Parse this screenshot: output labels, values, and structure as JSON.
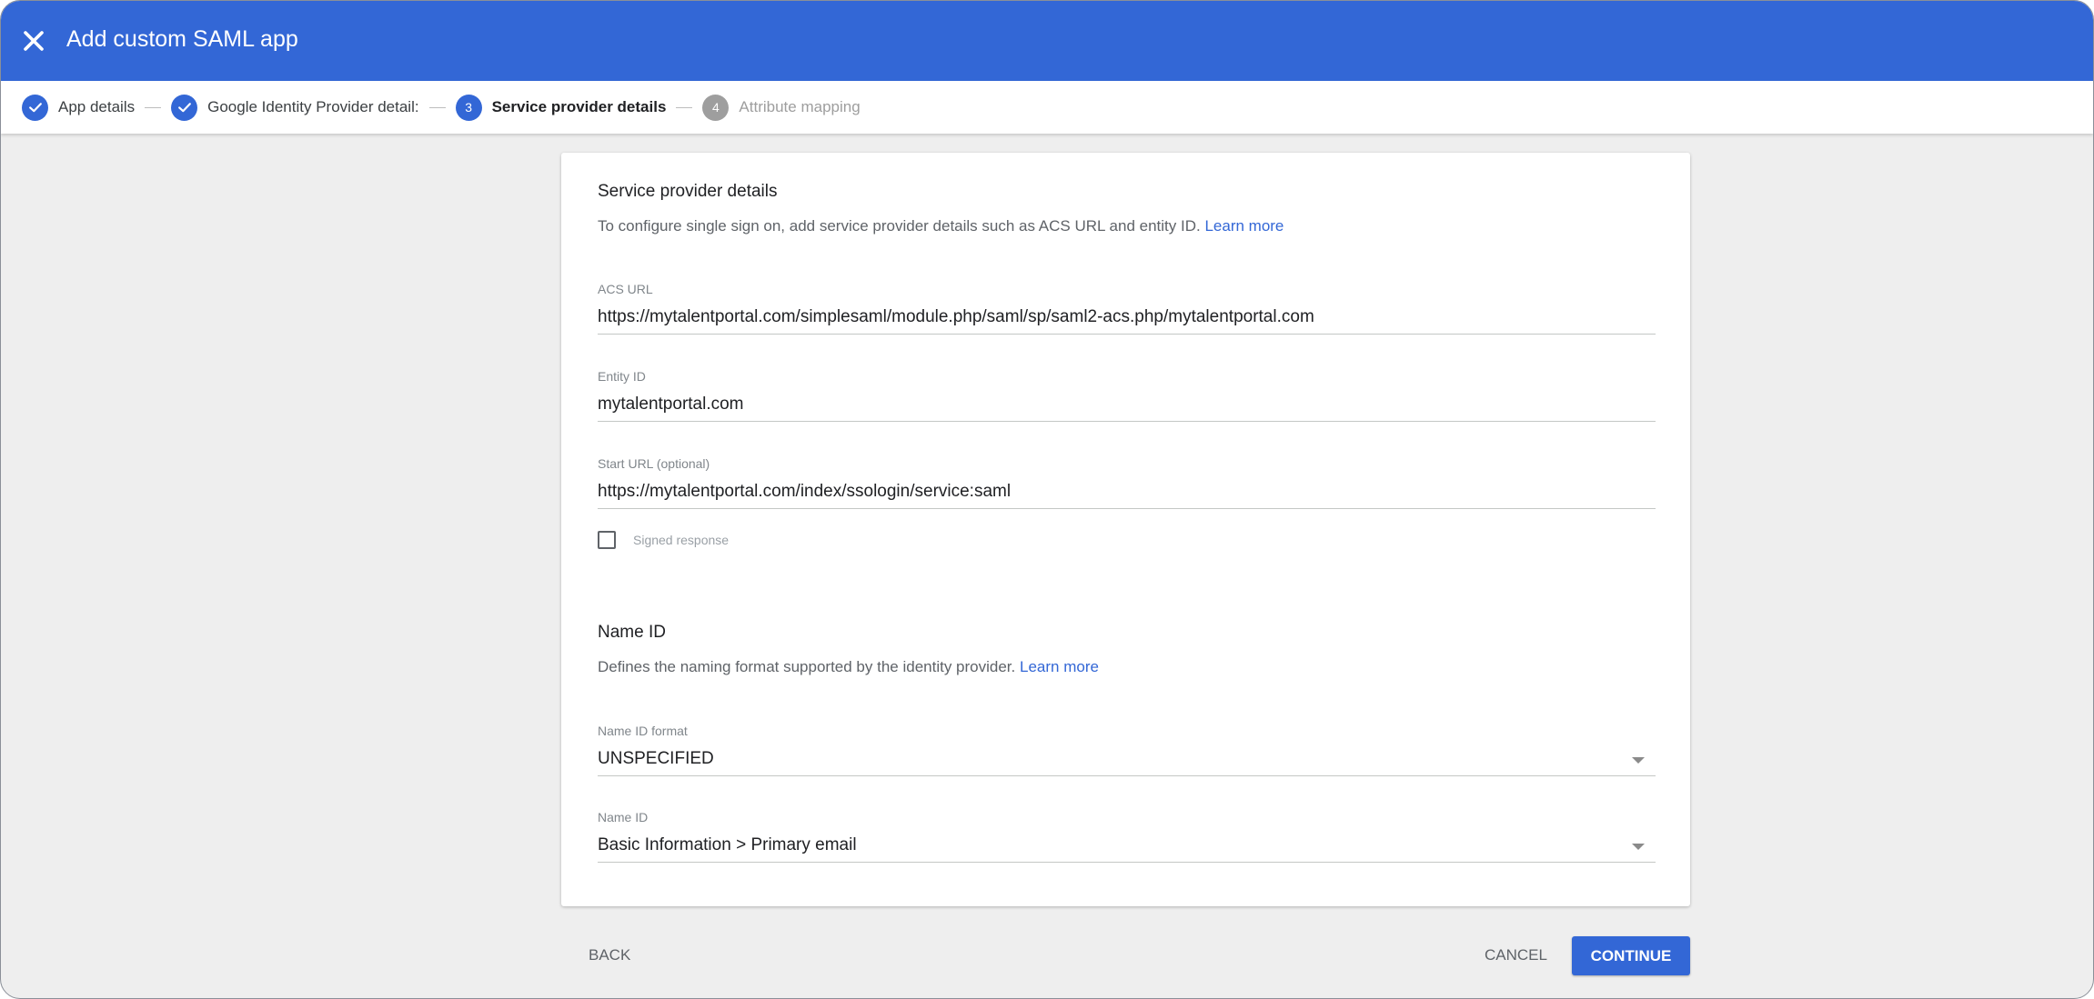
{
  "header": {
    "title": "Add custom SAML app",
    "close_icon": "close-icon",
    "background_color": "#3367d6"
  },
  "stepper": {
    "steps": [
      {
        "number": "1",
        "label": "App details",
        "state": "done"
      },
      {
        "number": "2",
        "label": "Google Identity Provider detail:",
        "state": "done"
      },
      {
        "number": "3",
        "label": "Service provider details",
        "state": "active"
      },
      {
        "number": "4",
        "label": "Attribute mapping",
        "state": "pending"
      }
    ]
  },
  "service_provider": {
    "title": "Service provider details",
    "description": "To configure single sign on, add service provider details such as ACS URL and entity ID.",
    "learn_more": "Learn more",
    "acs_url": {
      "label": "ACS URL",
      "value": "https://mytalentportal.com/simplesaml/module.php/saml/sp/saml2-acs.php/mytalentportal.com"
    },
    "entity_id": {
      "label": "Entity ID",
      "value": "mytalentportal.com"
    },
    "start_url": {
      "label": "Start URL (optional)",
      "value": "https://mytalentportal.com/index/ssologin/service:saml"
    },
    "signed_response": {
      "label": "Signed response",
      "checked": false
    }
  },
  "name_id": {
    "title": "Name ID",
    "description": "Defines the naming format supported by the identity provider.",
    "learn_more": "Learn more",
    "format": {
      "label": "Name ID format",
      "value": "UNSPECIFIED"
    },
    "name_id": {
      "label": "Name ID",
      "value": "Basic Information > Primary email"
    }
  },
  "footer": {
    "back": "BACK",
    "cancel": "CANCEL",
    "continue": "CONTINUE"
  }
}
